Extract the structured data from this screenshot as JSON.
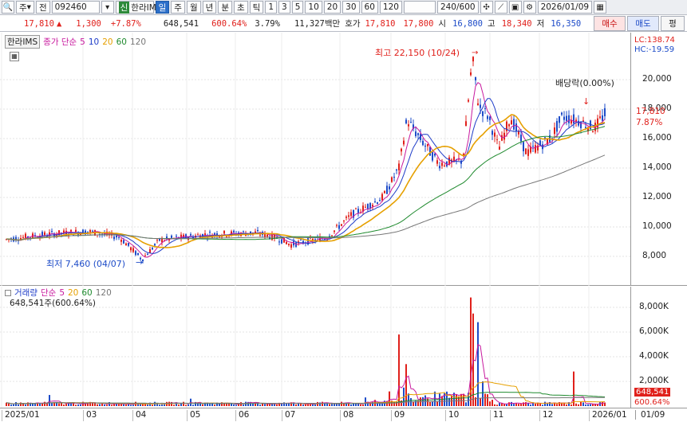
{
  "toolbar": {
    "market": "주",
    "type": "전",
    "code": "092460",
    "badge": "신",
    "name": "한라IMS",
    "periods": [
      "일",
      "주",
      "월",
      "년",
      "분",
      "초",
      "틱"
    ],
    "minutes": [
      "1",
      "3",
      "5",
      "10",
      "20",
      "30",
      "60",
      "120"
    ],
    "count": "240/600",
    "date": "2026/01/09"
  },
  "quote": {
    "price": "17,810",
    "change": "1,300",
    "pct": "+7.87%",
    "volume": "648,541",
    "vol_ratio": "600.64%",
    "turnover": "3.79%",
    "amount": "11,327백만",
    "ask_label": "호가",
    "ask": "17,810",
    "bid": "17,800",
    "open_label": "시",
    "open": "16,800",
    "high_label": "고",
    "high": "18,340",
    "low_label": "저",
    "low": "16,350",
    "buy": "매수",
    "sell": "매도",
    "eval": "평"
  },
  "price_legend": {
    "name": "한라IMS",
    "ma_title": "종가 단순",
    "ma": [
      "5",
      "10",
      "20",
      "60",
      "120"
    ],
    "ma_colors": [
      "#c8199e",
      "#1e3cc8",
      "#e6a000",
      "#1f8a2e",
      "#777777"
    ]
  },
  "price_axis": {
    "lc": "LC:138.74",
    "hc": "HC:-19.59",
    "ticks": [
      "20,000",
      "18,000",
      "16,000",
      "14,000",
      "12,000",
      "10,000",
      "8,000"
    ],
    "current": "17,810",
    "current_pct": "7.87%"
  },
  "annotations": {
    "high": "최고 22,150 (10/24)",
    "low": "최저 7,460 (04/07)",
    "dividend": "배당락(0.00%)"
  },
  "vol_legend": {
    "title": "거래량",
    "ma_title": "단순",
    "ma": [
      "5",
      "20",
      "60",
      "120"
    ],
    "value": "648,541주(600.64%)"
  },
  "vol_axis": {
    "ticks": [
      "8,000K",
      "6,000K",
      "4,000K",
      "2,000K"
    ],
    "current": "648,541",
    "current_pct": "600.64%"
  },
  "xaxis": {
    "labels": [
      "2025/01",
      "03",
      "04",
      "05",
      "06",
      "07",
      "08",
      "09",
      "10",
      "11",
      "12",
      "2026/01"
    ],
    "right": "01/09"
  },
  "colors": {
    "up": "#e0201b",
    "down": "#1e4cc8",
    "ma5": "#c8199e",
    "ma10": "#1e3cc8",
    "ma20": "#e6a000",
    "ma60": "#1f8a2e",
    "ma120": "#777777"
  }
}
